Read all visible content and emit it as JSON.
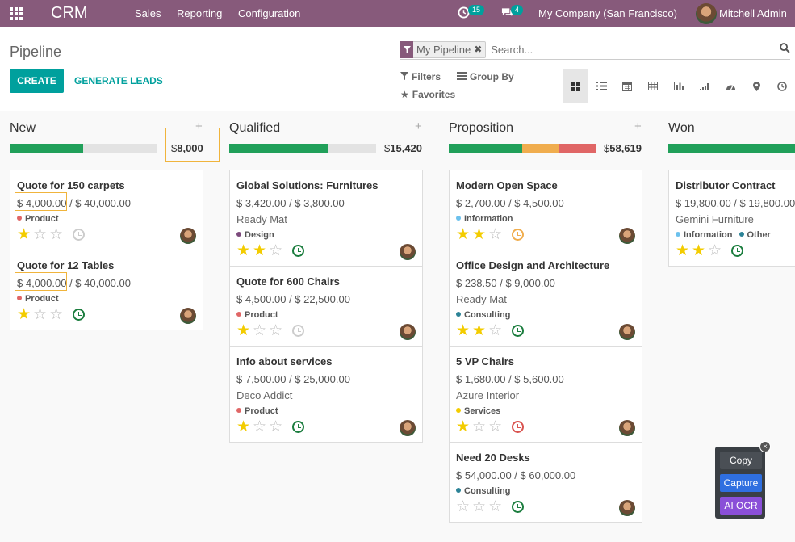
{
  "navbar": {
    "brand": "CRM",
    "menu": [
      "Sales",
      "Reporting",
      "Configuration"
    ],
    "activity_count": "15",
    "message_count": "4",
    "company": "My Company (San Francisco)",
    "user": "Mitchell Admin"
  },
  "control_panel": {
    "title": "Pipeline",
    "create_label": "CREATE",
    "generate_label": "GENERATE LEADS",
    "facet_label": "My Pipeline",
    "search_placeholder": "Search...",
    "filters_label": "Filters",
    "groupby_label": "Group By",
    "favorites_label": "Favorites"
  },
  "colors": {
    "navbar": "#875a7b",
    "primary": "#00a09d",
    "progress_green": "#21a05a",
    "progress_orange": "#f0ad4e",
    "progress_red": "#e06666",
    "star": "#f3cc00"
  },
  "columns": [
    {
      "title": "New",
      "currency": "$",
      "sum": "8,000",
      "progress": [
        {
          "fraction": 0.5,
          "color": "#21a05a"
        }
      ],
      "cards": [
        {
          "title": "Quote for 150 carpets",
          "amount_a": "$ 4,000.00",
          "amount_sep": " / ",
          "amount_b": "$ 40,000.00",
          "partner": "",
          "tags": [
            {
              "label": "Product",
              "color": "#e06666"
            }
          ],
          "stars": 1,
          "activity": "#cccccc"
        },
        {
          "title": "Quote for 12 Tables",
          "amount_a": "$ 4,000.00",
          "amount_sep": " / ",
          "amount_b": "$ 40,000.00",
          "partner": "",
          "tags": [
            {
              "label": "Product",
              "color": "#e06666"
            }
          ],
          "stars": 1,
          "activity": "#1b7d3e"
        }
      ]
    },
    {
      "title": "Qualified",
      "currency": "$",
      "sum": "15,420",
      "progress": [
        {
          "fraction": 0.67,
          "color": "#21a05a"
        }
      ],
      "cards": [
        {
          "title": "Global Solutions: Furnitures",
          "amount_a": "$ 3,420.00",
          "amount_sep": " / ",
          "amount_b": "$ 3,800.00",
          "partner": "Ready Mat",
          "tags": [
            {
              "label": "Design",
              "color": "#7c4a7c"
            }
          ],
          "stars": 2,
          "activity": "#1b7d3e"
        },
        {
          "title": "Quote for 600 Chairs",
          "amount_a": "$ 4,500.00",
          "amount_sep": " / ",
          "amount_b": "$ 22,500.00",
          "partner": "",
          "tags": [
            {
              "label": "Product",
              "color": "#e06666"
            }
          ],
          "stars": 1,
          "activity": "#cccccc"
        },
        {
          "title": "Info about services",
          "amount_a": "$ 7,500.00",
          "amount_sep": " / ",
          "amount_b": "$ 25,000.00",
          "partner": "Deco Addict",
          "tags": [
            {
              "label": "Product",
              "color": "#e06666"
            }
          ],
          "stars": 1,
          "activity": "#1b7d3e"
        }
      ]
    },
    {
      "title": "Proposition",
      "currency": "$",
      "sum": "58,619",
      "progress": [
        {
          "fraction": 0.5,
          "color": "#21a05a"
        },
        {
          "fraction": 0.25,
          "color": "#f0ad4e"
        },
        {
          "fraction": 0.25,
          "color": "#e06666"
        }
      ],
      "cards": [
        {
          "title": "Modern Open Space",
          "amount_a": "$ 2,700.00",
          "amount_sep": " / ",
          "amount_b": "$ 4,500.00",
          "partner": "",
          "tags": [
            {
              "label": "Information",
              "color": "#6cc1ed"
            }
          ],
          "stars": 2,
          "activity": "#f0ad4e"
        },
        {
          "title": "Office Design and Architecture",
          "amount_a": "$ 238.50",
          "amount_sep": " / ",
          "amount_b": "$ 9,000.00",
          "partner": "Ready Mat",
          "tags": [
            {
              "label": "Consulting",
              "color": "#2c8397"
            }
          ],
          "stars": 2,
          "activity": "#1b7d3e"
        },
        {
          "title": "5 VP Chairs",
          "amount_a": "$ 1,680.00",
          "amount_sep": " / ",
          "amount_b": "$ 5,600.00",
          "partner": "Azure Interior",
          "tags": [
            {
              "label": "Services",
              "color": "#f3cc00"
            }
          ],
          "stars": 1,
          "activity": "#d9534f"
        },
        {
          "title": "Need 20 Desks",
          "amount_a": "$ 54,000.00",
          "amount_sep": " / ",
          "amount_b": "$ 60,000.00",
          "partner": "",
          "tags": [
            {
              "label": "Consulting",
              "color": "#2c8397"
            }
          ],
          "stars": 0,
          "activity": "#1b7d3e"
        }
      ]
    },
    {
      "title": "Won",
      "currency": "",
      "sum": "",
      "progress": [
        {
          "fraction": 1,
          "color": "#21a05a"
        }
      ],
      "cards": [
        {
          "title": "Distributor Contract",
          "amount_a": "$ 19,800.00",
          "amount_sep": " / ",
          "amount_b": "$ 19,800.00",
          "partner": "Gemini Furniture",
          "tags": [
            {
              "label": "Information",
              "color": "#6cc1ed"
            },
            {
              "label": "Other",
              "color": "#2c8397"
            }
          ],
          "stars": 2,
          "activity": "#1b7d3e"
        }
      ]
    }
  ],
  "float_tool": {
    "copy": "Copy",
    "capture": "Capture",
    "ocr": "AI OCR",
    "close": "×"
  }
}
